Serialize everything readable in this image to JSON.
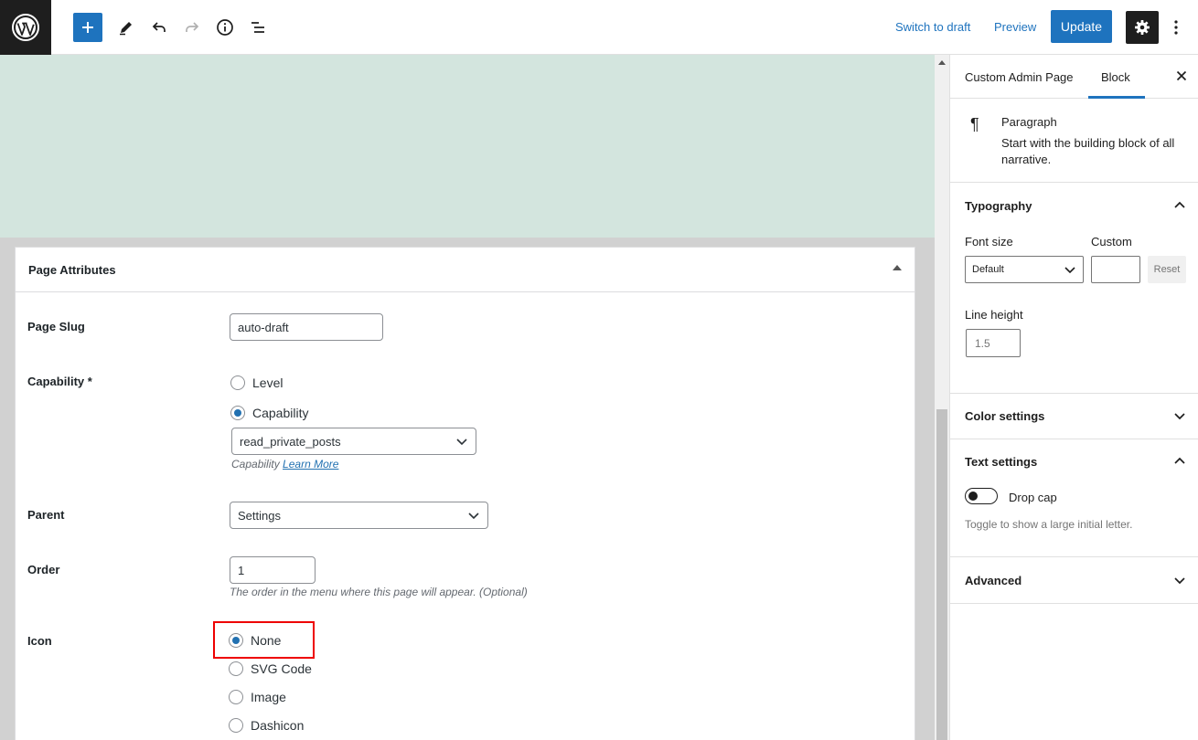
{
  "colors": {
    "accent": "#1e73be",
    "highlight": "#e00000",
    "canvas": "#d3e5de"
  },
  "toolbar": {
    "logo_icon": "wordpress-logo",
    "switch_draft": "Switch to draft",
    "preview": "Preview",
    "update": "Update"
  },
  "metabox": {
    "title": "Page Attributes",
    "page_slug": {
      "label": "Page Slug",
      "value": "auto-draft"
    },
    "capability": {
      "label": "Capability *",
      "options": [
        "Level",
        "Capability"
      ],
      "selected": "Capability",
      "select_value": "read_private_posts",
      "hint": "Capability",
      "hint_link": "Learn More"
    },
    "parent": {
      "label": "Parent",
      "value": "Settings"
    },
    "order": {
      "label": "Order",
      "value": "1",
      "hint": "The order in the menu where this page will appear. (Optional)"
    },
    "icon": {
      "label": "Icon",
      "options": [
        "None",
        "SVG Code",
        "Image",
        "Dashicon"
      ],
      "selected": "None"
    }
  },
  "sidebar": {
    "tabs": [
      "Custom Admin Page",
      "Block"
    ],
    "active_tab": "Block",
    "block": {
      "title": "Paragraph",
      "description": "Start with the building block of all narrative."
    },
    "typography": {
      "title": "Typography",
      "font_size_label": "Font size",
      "font_size_value": "Default",
      "custom_label": "Custom",
      "reset": "Reset",
      "line_height_label": "Line height",
      "line_height_placeholder": "1.5"
    },
    "color_settings": "Color settings",
    "text_settings": {
      "title": "Text settings",
      "drop_cap": "Drop cap",
      "help": "Toggle to show a large initial letter."
    },
    "advanced": "Advanced"
  }
}
